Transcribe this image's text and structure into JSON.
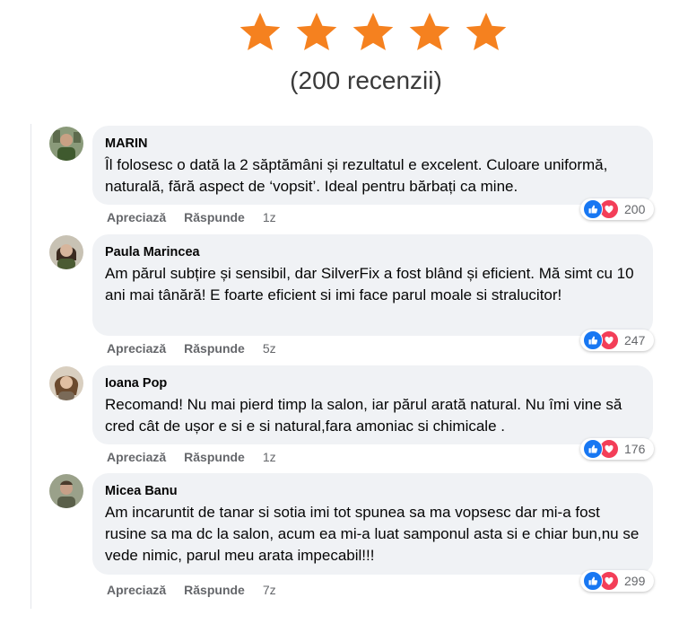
{
  "rating": {
    "stars": 5,
    "star_color": "#f5811f",
    "review_count": "(200 recenzii)"
  },
  "comments": [
    {
      "name": "MARIN",
      "text": "Îl folosesc o dată la 2 săptămâni și rezultatul e excelent. Culoare uniformă, naturală, fără aspect de ‘vopsit’. Ideal pentru bărbați ca mine.",
      "like_label": "Apreciază",
      "reply_label": "Răspunde",
      "time": "1z",
      "reactions": "200"
    },
    {
      "name": "Paula Marincea",
      "text": "Am părul subțire și sensibil, dar SilverFix a fost blând și eficient. Mă simt cu 10 ani mai tânără! E foarte eficient si imi face parul moale si stralucitor!",
      "like_label": "Apreciază",
      "reply_label": "Răspunde",
      "time": "5z",
      "reactions": "247"
    },
    {
      "name": "Ioana Pop",
      "text": "Recomand! Nu mai pierd timp la salon, iar părul arată natural. Nu îmi vine să cred cât de ușor e si e si natural,fara amoniac si chimicale .",
      "like_label": "Apreciază",
      "reply_label": "Răspunde",
      "time": "1z",
      "reactions": "176"
    },
    {
      "name": "Micea Banu",
      "text": "Am incaruntit de tanar si sotia imi tot spunea sa ma vopsesc dar mi-a fost rusine sa ma dc la salon, acum ea mi-a luat samponul asta si e chiar bun,nu se vede nimic, parul meu arata impecabil!!!",
      "like_label": "Apreciază",
      "reply_label": "Răspunde",
      "time": "7z",
      "reactions": "299"
    }
  ],
  "colors": {
    "bubble": "#f0f2f5",
    "like_blue": "#1877f2",
    "love_red": "#f33e58",
    "meta_gray": "#65676b"
  }
}
